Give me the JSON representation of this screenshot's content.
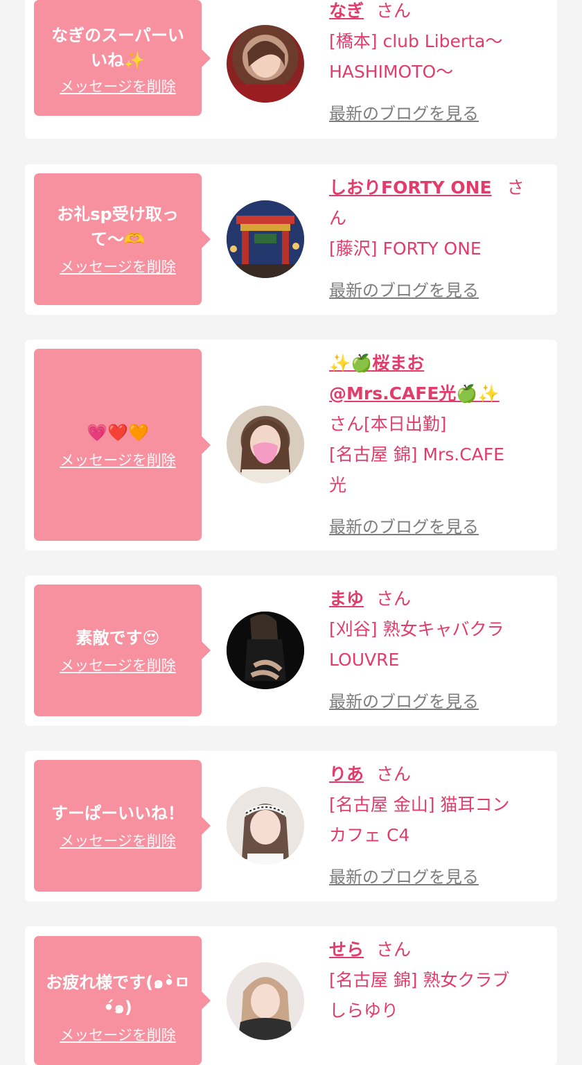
{
  "cards": [
    {
      "message": "なぎのスーパーい\nいね✨",
      "delete_label": "メッセージを削除",
      "name": "なぎ",
      "san": "さん",
      "shop_line1": "[橋本] club Liberta〜",
      "shop_line2": "HASHIMOTO〜",
      "blog_label": "最新のブログを見る",
      "avatar": "woman-portrait-avatar"
    },
    {
      "message": "お礼sp受け取っ\nて〜🫶",
      "delete_label": "メッセージを削除",
      "name": "しおりFORTY ONE",
      "san": "さ\nん",
      "shop_line1": "[藤沢] FORTY ONE",
      "blog_label": "最新のブログを見る",
      "avatar": "chinatown-gate-avatar"
    },
    {
      "message": "💗❤️🧡",
      "delete_label": "メッセージを削除",
      "name_line1": "✨🍏桜まお",
      "name_line2": "@Mrs.CAFE光🍏✨",
      "san": "さん[本日出勤]",
      "shop_line1": "[名古屋 錦] Mrs.CAFE",
      "shop_line2": "光",
      "blog_label": "最新のブログを見る",
      "avatar": "masked-woman-avatar"
    },
    {
      "message": "素敵です😍",
      "delete_label": "メッセージを削除",
      "name": "まゆ",
      "san": "さん",
      "shop_line1": "[刈谷] 熟女キャバクラ",
      "shop_line2": "LOUVRE",
      "blog_label": "最新のブログを見る",
      "avatar": "dark-dress-avatar"
    },
    {
      "message": "すーぱーいいね！",
      "delete_label": "メッセージを削除",
      "name": "りあ",
      "san": "さん",
      "shop_line1": "[名古屋 金山] 猫耳コン",
      "shop_line2": "カフェ C4",
      "blog_label": "最新のブログを見る",
      "avatar": "girl-headband-avatar"
    },
    {
      "message": "お疲れ様です(๑•̀ㅁ\n•́๑)",
      "delete_label": "メッセージを削除",
      "name": "せら",
      "san": "さん",
      "shop_line1": "[名古屋 錦] 熟女クラブ",
      "shop_line2": "しらゆり",
      "avatar": "blonde-woman-avatar"
    }
  ],
  "colors": {
    "bubble": "#f7909f",
    "accent": "#e23c6b",
    "blog_link": "#7d7d7d",
    "background": "#f4f4f4"
  }
}
